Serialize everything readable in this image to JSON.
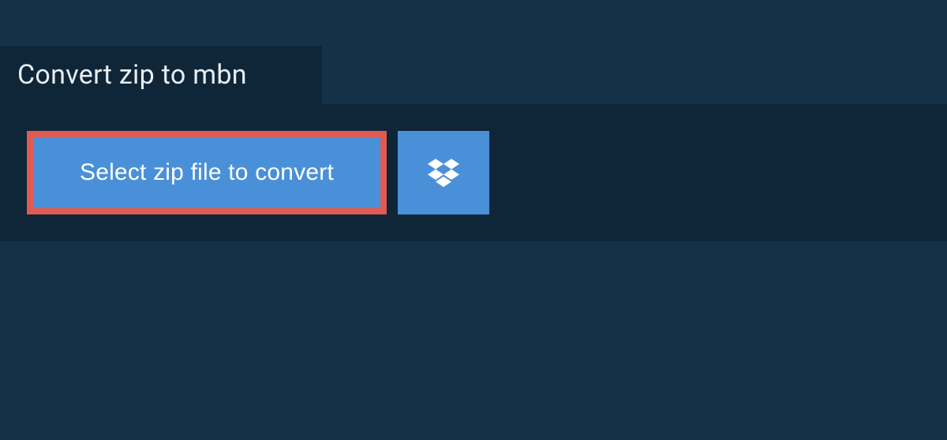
{
  "header": {
    "title": "Convert zip to mbn"
  },
  "actions": {
    "select_file_label": "Select zip file to convert"
  },
  "colors": {
    "page_bg": "#14314a",
    "panel_bg": "#0f2638",
    "button_bg": "#4a90d9",
    "highlight_border": "#e05a52",
    "text_light": "#e8eef3"
  }
}
